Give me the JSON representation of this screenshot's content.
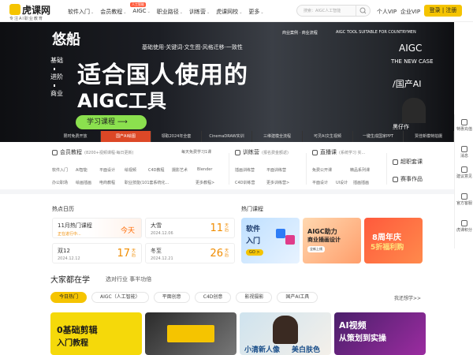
{
  "header": {
    "logo_name": "虎课网",
    "logo_sub": "专注AI职业教育",
    "nav": [
      {
        "label": "软件入门",
        "caret": "⌄"
      },
      {
        "label": "会员教程",
        "caret": "⌄"
      },
      {
        "label": "AIGC",
        "caret": "⌄"
      },
      {
        "label": "职业路径",
        "caret": "⌄"
      },
      {
        "label": "训练营",
        "caret": "⌄"
      },
      {
        "label": "虎课网校",
        "caret": "⌄"
      },
      {
        "label": "更多",
        "caret": "⌄"
      }
    ],
    "new_tag": "人工智能",
    "search_placeholder": "搜索：AIGC人工智能",
    "vip": "个人VIP",
    "enterprise": "企业VIP",
    "login": "登录 | 注册"
  },
  "banner": {
    "brand": "悠船",
    "left_lines": [
      "基础",
      "进阶",
      "商业"
    ],
    "tags": "基础使用·关键词·文生图·风格迁移·一致性",
    "headline": "适合国人使用的",
    "headline2": "AIGC工具",
    "cta": "学习课程 ⟶",
    "case_top": "商业案例  ·  商业流程",
    "case_en": "AIGC TOOL SUITABLE FOR COUNTRYMEN",
    "right_title": "AIGC",
    "right_case": "THE NEW CASE",
    "right_china": "/国产AI",
    "person_name": "黑仔作",
    "thumbs": [
      "限时免费开放",
      "国产AI绘图",
      "领取2024年全套",
      "CinemaDRAW实训",
      "三维建模全流程",
      "可灵AI文生视频",
      "一键生成国家PPT",
      "贾佳新模特拍摄"
    ],
    "active_thumb": 1
  },
  "sidebar": [
    {
      "label": "特惠充值",
      "icon": "gift-icon"
    },
    {
      "label": "消息",
      "icon": "bell-icon"
    },
    {
      "label": "建议意见",
      "icon": "feedback-icon"
    },
    {
      "label": "官方客服",
      "icon": "headset-icon"
    },
    {
      "label": "虎课积分",
      "icon": "coin-icon"
    }
  ],
  "categories": {
    "vip": {
      "title": "会员教程",
      "sub": "(8200+视频课程·每日更新)",
      "more": "每天免费学习1课"
    },
    "vip_links": [
      "软件入门",
      "AI智能",
      "平面设计",
      "绘视频",
      "C4D教程",
      "摄影艺术",
      "Blender",
      "办公职场",
      "绘画插画",
      "电商教程",
      "职业技能(101套系统化...",
      "更多教程>"
    ],
    "camp": {
      "title": "训练营",
      "sub": "(报名费金额返)"
    },
    "camp_links": [
      "插画训练营",
      "平面训练营",
      "C4D训练营",
      "更多训练营>"
    ],
    "live": {
      "title": "直播课",
      "sub": "(系统学习 实..."
    },
    "live_links": [
      "免费公开课",
      "精品系列课",
      "平面设计",
      "UI设计",
      "插画插画"
    ],
    "extra": [
      "超职套课",
      "赛事作品"
    ]
  },
  "hot_calendar": {
    "title": "热点日历",
    "items": [
      {
        "name": "11月热门课程",
        "date": "正在进行中...",
        "today": "今天"
      },
      {
        "name": "大雪",
        "date": "2024.12.06",
        "days": "11",
        "unit": "天后"
      },
      {
        "name": "双12",
        "date": "2024.12.12",
        "days": "17",
        "unit": "天后"
      },
      {
        "name": "冬至",
        "date": "2024.12.21",
        "days": "26",
        "unit": "天后"
      }
    ]
  },
  "hot_courses": {
    "title": "热门课程",
    "items": [
      {
        "line1": "软件",
        "line2": "入门",
        "btn": "GO >"
      },
      {
        "line1": "AIGC助力",
        "line2": "商业插画设计",
        "btn": "全新上线"
      },
      {
        "line1": "8周年庆",
        "line2": "5折福利购",
        "btn": ""
      }
    ]
  },
  "everyone": {
    "title": "大家都在学",
    "sub": "选对行业 事半功倍",
    "tabs": [
      "今日热门",
      "AIGC（人工智能）",
      "平面创意",
      "C4D创意",
      "影视摄影",
      "国产AI工具"
    ],
    "active_tab": 0,
    "interest": "我还想学>>"
  },
  "cards": [
    {
      "text": "0基础剪辑",
      "text2": "入门教程"
    },
    {
      "text": "",
      "text2": ""
    },
    {
      "text": "小清新人像",
      "text2": "美白肤色"
    },
    {
      "text": "AI视频",
      "text2": "从策划到实操"
    }
  ],
  "colors": {
    "brand": "#f5c400",
    "accent": "#ff6a00",
    "green": "#8be04e"
  }
}
